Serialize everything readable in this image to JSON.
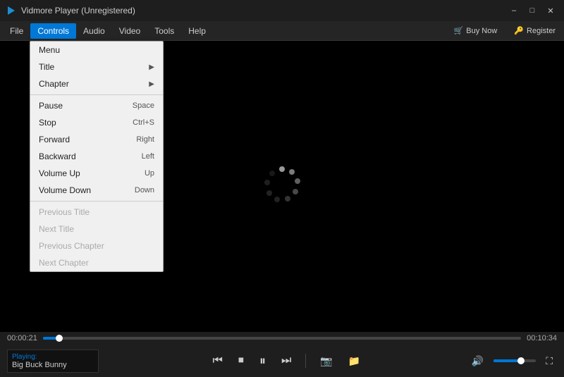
{
  "titleBar": {
    "title": "Vidmore Player (Unregistered)",
    "minBtn": "–",
    "maxBtn": "□",
    "closeBtn": "✕"
  },
  "menuBar": {
    "items": [
      {
        "label": "File",
        "id": "file"
      },
      {
        "label": "Controls",
        "id": "controls",
        "active": true
      },
      {
        "label": "Audio",
        "id": "audio"
      },
      {
        "label": "Video",
        "id": "video"
      },
      {
        "label": "Tools",
        "id": "tools"
      },
      {
        "label": "Help",
        "id": "help"
      }
    ],
    "buyNow": "Buy Now",
    "register": "Register"
  },
  "dropdown": {
    "items": [
      {
        "label": "Menu",
        "shortcut": "",
        "hasArrow": false,
        "disabled": false
      },
      {
        "label": "Title",
        "shortcut": "",
        "hasArrow": true,
        "disabled": false
      },
      {
        "label": "Chapter",
        "shortcut": "",
        "hasArrow": true,
        "disabled": false
      },
      {
        "separator": true
      },
      {
        "label": "Pause",
        "shortcut": "Space",
        "hasArrow": false,
        "disabled": false
      },
      {
        "label": "Stop",
        "shortcut": "Ctrl+S",
        "hasArrow": false,
        "disabled": false
      },
      {
        "label": "Forward",
        "shortcut": "Right",
        "hasArrow": false,
        "disabled": false
      },
      {
        "label": "Backward",
        "shortcut": "Left",
        "hasArrow": false,
        "disabled": false
      },
      {
        "label": "Volume Up",
        "shortcut": "Up",
        "hasArrow": false,
        "disabled": false
      },
      {
        "label": "Volume Down",
        "shortcut": "Down",
        "hasArrow": false,
        "disabled": false
      },
      {
        "separator": true
      },
      {
        "label": "Previous Title",
        "shortcut": "",
        "hasArrow": false,
        "disabled": true
      },
      {
        "label": "Next Title",
        "shortcut": "",
        "hasArrow": false,
        "disabled": true
      },
      {
        "label": "Previous Chapter",
        "shortcut": "",
        "hasArrow": false,
        "disabled": true
      },
      {
        "label": "Next Chapter",
        "shortcut": "",
        "hasArrow": false,
        "disabled": true
      }
    ]
  },
  "controls": {
    "timeLeft": "00:00:21",
    "timeRight": "00:10:34",
    "progressPercent": 3.4,
    "volumePercent": 65,
    "playing": "Playing:",
    "trackTitle": "Big Buck Bunny"
  }
}
